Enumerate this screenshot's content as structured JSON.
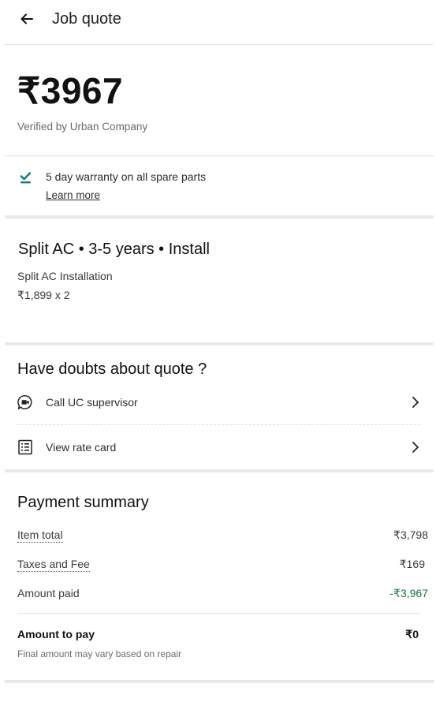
{
  "header": {
    "title": "Job quote",
    "back_icon": "arrow-left-icon"
  },
  "quote": {
    "amount": "₹3967",
    "verified_text": "Verified by Urban Company"
  },
  "warranty": {
    "icon": "check-badge-icon",
    "text": "5 day warranty on all spare parts",
    "learn_more": "Learn more",
    "accent_color": "#0f7f7c"
  },
  "service": {
    "title": "Split AC  • 3-5 years • Install",
    "name": "Split AC Installation",
    "price_line": "₹1,899 x 2"
  },
  "doubts": {
    "title": "Have doubts about quote ?",
    "items": [
      {
        "label": "Call UC supervisor",
        "icon": "chat-video-icon"
      },
      {
        "label": "View rate card",
        "icon": "rate-card-icon"
      }
    ]
  },
  "payment": {
    "title": "Payment summary",
    "rows": [
      {
        "label": "Item total",
        "value": "₹3,798"
      },
      {
        "label": "Taxes and Fee",
        "value": "₹169"
      },
      {
        "label": "Amount paid",
        "value": "-₹3,967"
      }
    ],
    "to_pay_label": "Amount to pay",
    "to_pay_value": "₹0",
    "disclaimer": "Final amount may vary based on repair",
    "paid_color": "#0f7a3d"
  }
}
